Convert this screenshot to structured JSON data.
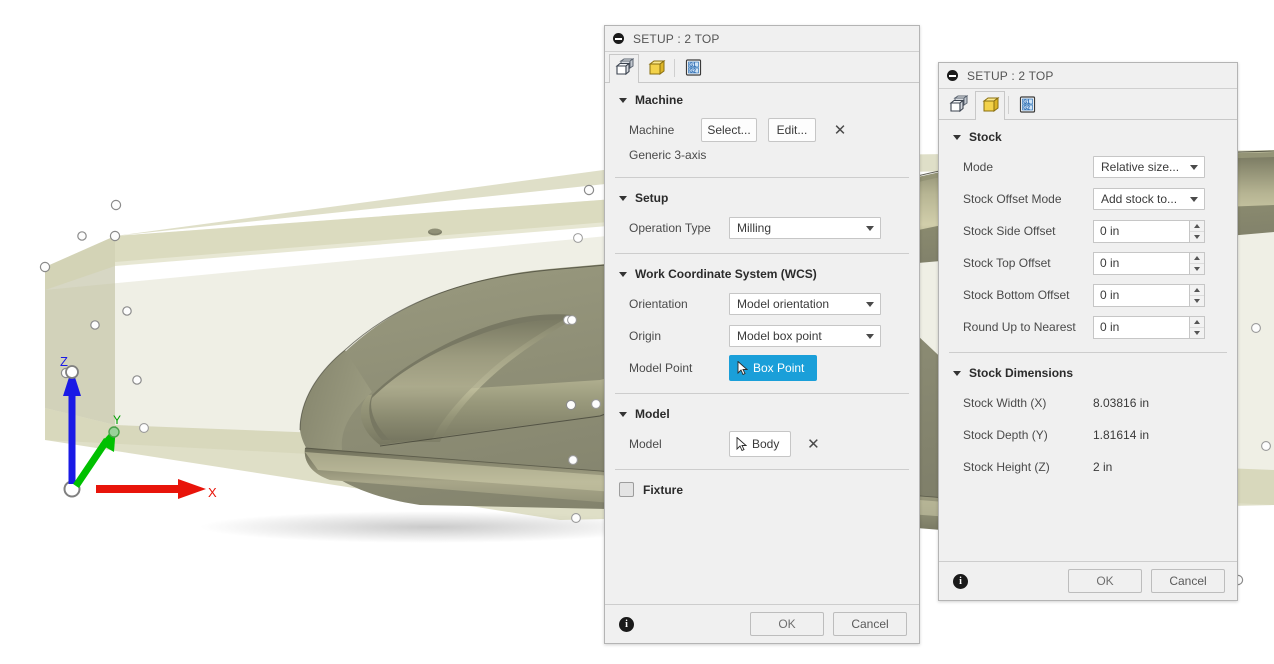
{
  "viewport": {
    "name": "3d-cad-viewport",
    "background": "#ffffff",
    "model_color": "#8f8f72",
    "stock_color": "#cfcfa8",
    "axes": {
      "x_label": "X",
      "y_label": "Y",
      "z_label": "Z",
      "x_color": "#e8140a",
      "y_color": "#00c000",
      "z_color": "#1a1ae6"
    }
  },
  "setup_dialog": {
    "title": "SETUP : 2 TOP",
    "collapse_icon": "minimize-icon",
    "tabs": [
      {
        "name": "setup-tab",
        "icon": "setup-cube-icon",
        "active": true
      },
      {
        "name": "stock-tab",
        "icon": "stock-cube-icon",
        "active": false
      },
      {
        "name": "post-process-tab",
        "icon": "g-code-icon",
        "label": "G1 G2",
        "active": false
      }
    ],
    "machine": {
      "heading": "Machine",
      "label": "Machine",
      "select_label": "Select...",
      "edit_label": "Edit...",
      "clear_icon": "close-x-icon",
      "value": "Generic 3-axis"
    },
    "setup": {
      "heading": "Setup",
      "operation_type_label": "Operation Type",
      "operation_type_value": "Milling"
    },
    "wcs": {
      "heading": "Work Coordinate System (WCS)",
      "orientation_label": "Orientation",
      "orientation_value": "Model orientation",
      "origin_label": "Origin",
      "origin_value": "Model box point",
      "model_point_label": "Model Point",
      "model_point_button": "Box Point",
      "model_point_button_color": "#1a9fd9"
    },
    "model": {
      "heading": "Model",
      "label": "Model",
      "button": "Body",
      "clear_icon": "close-x-icon"
    },
    "fixture": {
      "label": "Fixture",
      "checked": false
    },
    "footer": {
      "info_icon": "info-icon",
      "ok_label": "OK",
      "cancel_label": "Cancel"
    }
  },
  "stock_dialog": {
    "title": "SETUP : 2 TOP",
    "collapse_icon": "minimize-icon",
    "tabs": [
      {
        "name": "setup-tab",
        "icon": "setup-cube-icon",
        "active": false
      },
      {
        "name": "stock-tab",
        "icon": "stock-cube-icon",
        "active": true
      },
      {
        "name": "post-process-tab",
        "icon": "g-code-icon",
        "label": "G1 G2",
        "active": false
      }
    ],
    "stock": {
      "heading": "Stock",
      "fields": [
        {
          "label": "Mode",
          "value": "Relative size...",
          "type": "combo"
        },
        {
          "label": "Stock Offset Mode",
          "value": "Add stock to...",
          "type": "combo"
        },
        {
          "label": "Stock Side Offset",
          "value": "0 in",
          "type": "spinner"
        },
        {
          "label": "Stock Top Offset",
          "value": "0 in",
          "type": "spinner"
        },
        {
          "label": "Stock Bottom Offset",
          "value": "0 in",
          "type": "spinner"
        },
        {
          "label": "Round Up to Nearest",
          "value": "0 in",
          "type": "spinner"
        }
      ]
    },
    "dimensions": {
      "heading": "Stock Dimensions",
      "rows": [
        {
          "label": "Stock Width (X)",
          "value": "8.03816 in"
        },
        {
          "label": "Stock Depth (Y)",
          "value": "1.81614 in"
        },
        {
          "label": "Stock Height (Z)",
          "value": "2 in"
        }
      ]
    },
    "footer": {
      "info_icon": "info-icon",
      "ok_label": "OK",
      "cancel_label": "Cancel"
    }
  }
}
